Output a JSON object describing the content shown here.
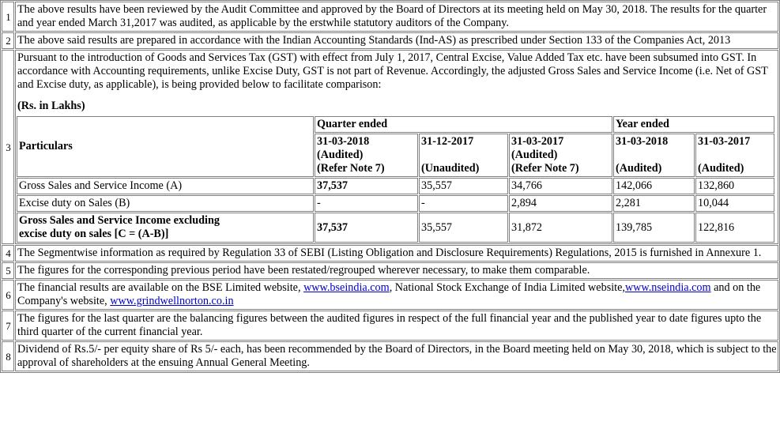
{
  "notes": [
    {
      "num": "1",
      "text": "The above results have been reviewed by the Audit Committee and approved by the Board of Directors at its meeting held on May 30, 2018. The results for the quarter and year ended March 31,2017 was audited, as applicable by the erstwhile statutory auditors of the Company."
    },
    {
      "num": "2",
      "text": "The above said results are prepared in accordance with the Indian Accounting Standards (Ind-AS) as prescribed under Section 133 of the Companies Act, 2013"
    },
    {
      "num": "3",
      "text": "Pursuant to the introduction of Goods and Services Tax (GST) with effect from July 1, 2017, Central Excise, Value Added Tax etc. have been subsumed into GST. In accordance with Accounting requirements, unlike Excise Duty, GST is not part of Revenue. Accordingly, the adjusted Gross Sales and Service Income (i.e. Net of GST and Excise duty, as applicable), is being provided below to facilitate comparison:",
      "unit": "(Rs. in Lakhs)"
    },
    {
      "num": "4",
      "text": "The Segmentwise information as required by Regulation 33 of SEBI (Listing Obligation and Disclosure Requirements) Regulations, 2015 is furnished in Annexure 1."
    },
    {
      "num": "5",
      "text": "The figures for the corresponding previous period have been restated/regrouped wherever necessary, to make them comparable."
    },
    {
      "num": "6",
      "text_a": "The financial results are available on the BSE Limited website, ",
      "link_a": "www.bseindia.com",
      "text_b": ", National Stock Exchange of India Limited website,",
      "link_b": "www.nseindia.com",
      "text_c": " and on the Company's website, ",
      "link_c": "www.grindwellnorton.co.in"
    },
    {
      "num": "7",
      "text": "The figures for the last quarter are the balancing figures between the audited figures in respect of the full financial year and the published year to date figures upto the third quarter of the current financial year."
    },
    {
      "num": "8",
      "text": "Dividend of Rs.5/- per equity share of Rs 5/- each, has been recommended by the Board of Directors, in the Board meeting held on May 30, 2018, which is subject to the approval of shareholders at the ensuing Annual General Meeting."
    }
  ],
  "table": {
    "particulars_label": "Particulars",
    "quarter_label": "Quarter ended",
    "year_label": "Year ended",
    "columns": [
      {
        "date": "31-03-2018",
        "status": "(Audited)",
        "note": "(Refer Note 7)"
      },
      {
        "date": "31-12-2017",
        "status": "(Unaudited)",
        "note": ""
      },
      {
        "date": "31-03-2017",
        "status": "(Audited)",
        "note": "(Refer Note 7)"
      },
      {
        "date": "31-03-2018",
        "status": "(Audited)",
        "note": ""
      },
      {
        "date": "31-03-2017",
        "status": "(Audited)",
        "note": ""
      }
    ],
    "rows": [
      {
        "label": "Gross Sales and Service Income (A)",
        "values": [
          "37,537",
          "35,557",
          "34,766",
          "142,066",
          "132,860"
        ]
      },
      {
        "label": "Excise duty on Sales (B)",
        "values": [
          "-",
          "-",
          "2,894",
          "2,281",
          "10,044"
        ]
      },
      {
        "label": "Gross Sales and Service Income excluding excise duty on sales [C = (A-B)]",
        "values": [
          "37,537",
          "35,557",
          "31,872",
          "139,785",
          "122,816"
        ]
      }
    ]
  }
}
